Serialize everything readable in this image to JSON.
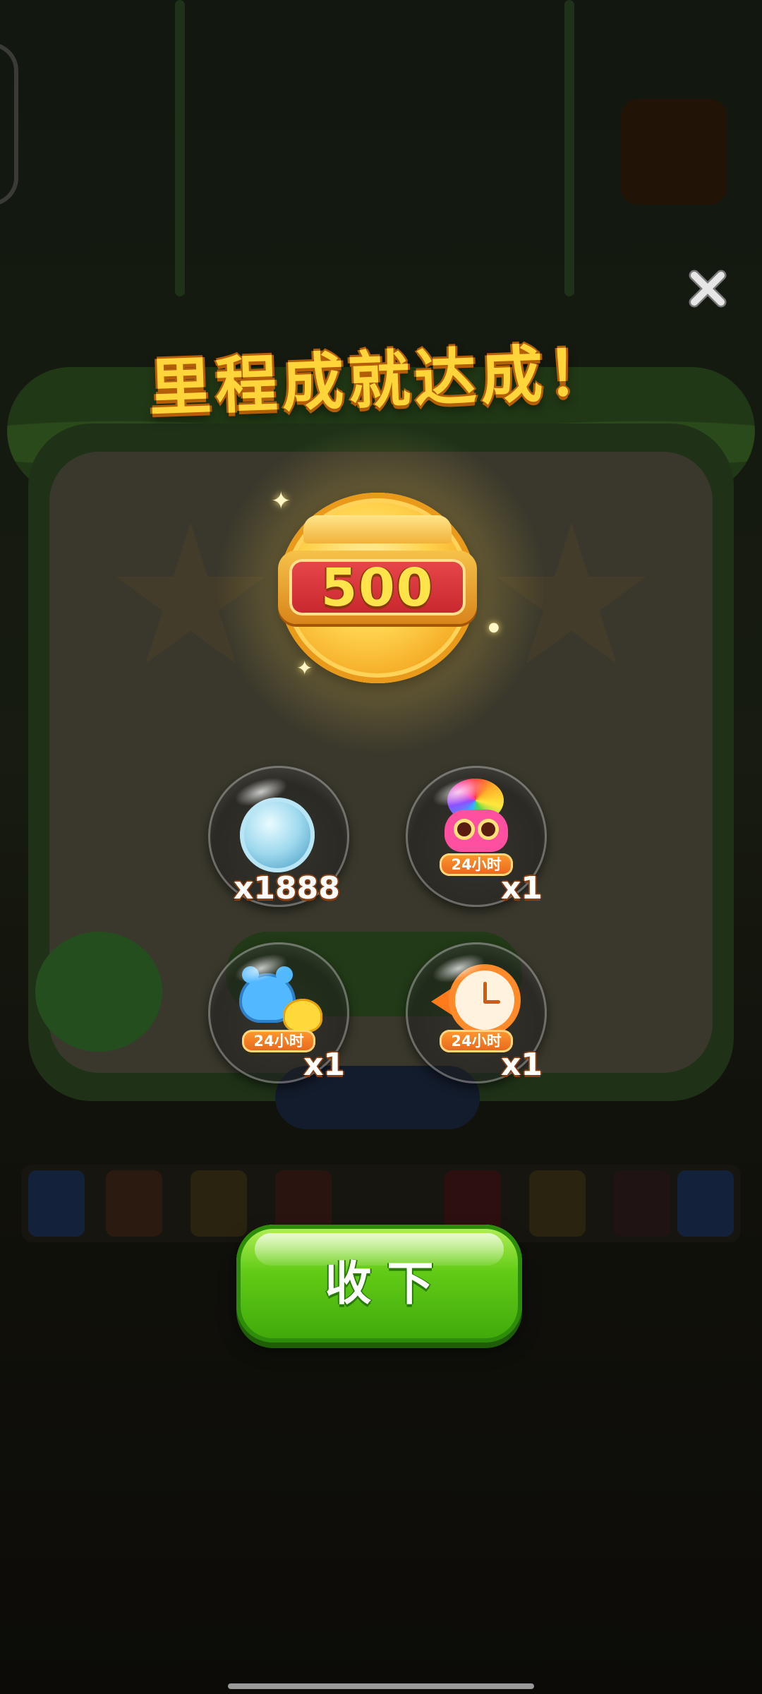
{
  "popup": {
    "title": "里程成就达成！",
    "milestone_value": "500"
  },
  "rewards": [
    {
      "icon": "leaf-coin-icon",
      "badge": "",
      "count": "x1888"
    },
    {
      "icon": "rainbow-owl-icon",
      "badge": "24小时",
      "count": "x1"
    },
    {
      "icon": "bear-and-chick-icon",
      "badge": "24小时",
      "count": "x1"
    },
    {
      "icon": "time-rewind-clock-icon",
      "badge": "24小时",
      "count": "x1"
    }
  ],
  "buttons": {
    "collect_label": "收下",
    "close_icon": "close-icon"
  },
  "colors": {
    "title": "#ffd53a",
    "title_outline": "#b55e08",
    "button_green": "#62cb16",
    "badge_orange": "#e7641b",
    "medal_red": "#c7262e",
    "medal_gold": "#ffd24d"
  }
}
